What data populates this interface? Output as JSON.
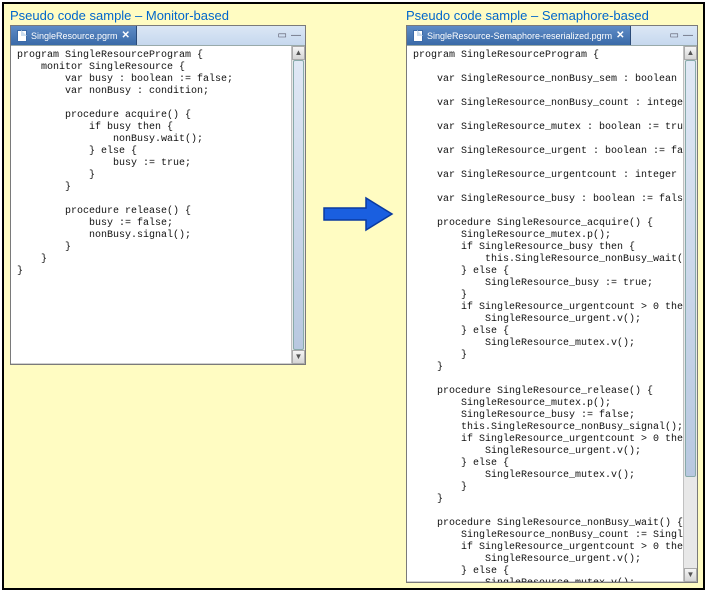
{
  "headings": {
    "left": "Pseudo code sample – Monitor-based",
    "right": "Pseudo code sample – Semaphore-based"
  },
  "tabs": {
    "left_filename": "SingleResource.pgrm",
    "right_filename": "SingleResource-Semaphore-reserialized.pgrm",
    "close_glyph": "✕",
    "restore_glyph": "▭",
    "min_glyph": "—"
  },
  "code_left": "program SingleResourceProgram {\n    monitor SingleResource {\n        var busy : boolean := false;\n        var nonBusy : condition;\n\n        procedure acquire() {\n            if busy then {\n                nonBusy.wait();\n            } else {\n                busy := true;\n            }\n        }\n\n        procedure release() {\n            busy := false;\n            nonBusy.signal();\n        }\n    }\n}",
  "code_right": "program SingleResourceProgram {\n\n    var SingleResource_nonBusy_sem : boolean := false;\n\n    var SingleResource_nonBusy_count : integer := 0;\n\n    var SingleResource_mutex : boolean := true;\n\n    var SingleResource_urgent : boolean := false;\n\n    var SingleResource_urgentcount : integer := 0;\n\n    var SingleResource_busy : boolean := false;\n\n    procedure SingleResource_acquire() {\n        SingleResource_mutex.p();\n        if SingleResource_busy then {\n            this.SingleResource_nonBusy_wait();\n        } else {\n            SingleResource_busy := true;\n        }\n        if SingleResource_urgentcount > 0 then {\n            SingleResource_urgent.v();\n        } else {\n            SingleResource_mutex.v();\n        }\n    }\n\n    procedure SingleResource_release() {\n        SingleResource_mutex.p();\n        SingleResource_busy := false;\n        this.SingleResource_nonBusy_signal();\n        if SingleResource_urgentcount > 0 then {\n            SingleResource_urgent.v();\n        } else {\n            SingleResource_mutex.v();\n        }\n    }\n\n    procedure SingleResource_nonBusy_wait() {\n        SingleResource_nonBusy_count := SingleResource_no\n        if SingleResource_urgentcount > 0 then {\n            SingleResource_urgent.v();\n        } else {\n            SingleResource_mutex.v();\n        }\n        SingleResource_nonBusy_sem.p();\n        SingleResource_nonBusy_count := SingleResource_no\n    }\n\n    procedure SingleResource_nonBusy_signal() {",
  "scrollbar": {
    "up_glyph": "▲",
    "down_glyph": "▼"
  },
  "arrow_color": "#1a5fe0"
}
